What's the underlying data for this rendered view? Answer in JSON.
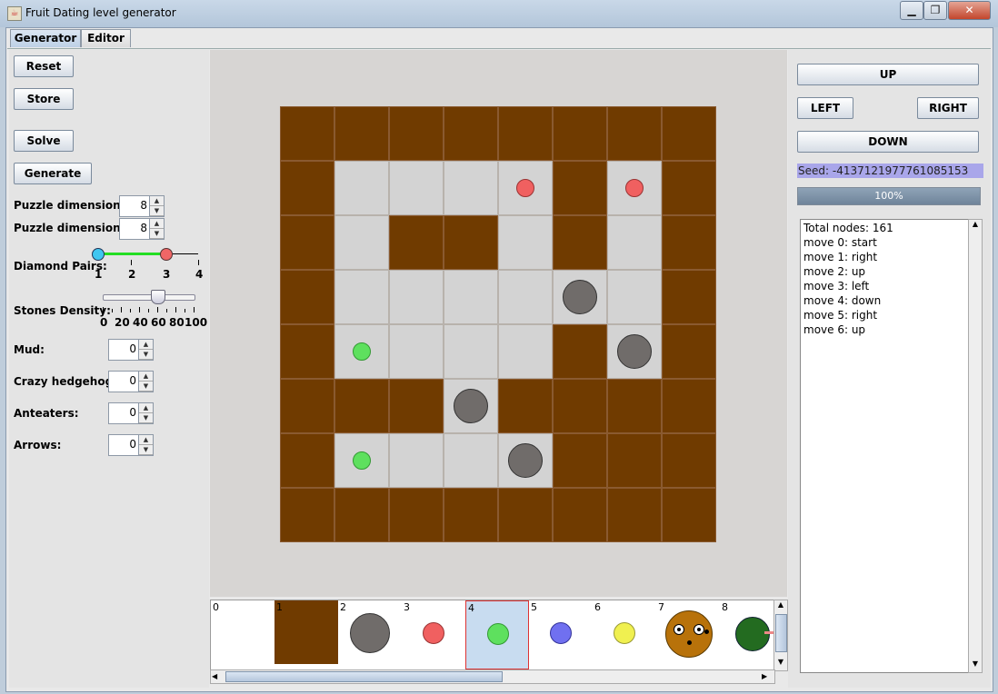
{
  "window": {
    "title": "Fruit Dating level generator",
    "minimize": "▁",
    "maximize": "❐",
    "close": "✕",
    "app_icon": "java-icon"
  },
  "tabs": [
    {
      "label": "Generator",
      "active": true
    },
    {
      "label": "Editor",
      "active": false
    }
  ],
  "left": {
    "reset": "Reset",
    "store": "Store",
    "solve": "Solve",
    "generate": "Generate",
    "dim_x_label": "Puzzle dimension X:",
    "dim_x": "8",
    "dim_y_label": "Puzzle dimension Y:",
    "dim_y": "8",
    "diamond_label": "Diamond Pairs:",
    "diamond_ticks": [
      "1",
      "2",
      "3",
      "4"
    ],
    "stones_label": "Stones Density:",
    "stones_ticks": [
      "0",
      "20",
      "40",
      "60",
      "80",
      "100"
    ],
    "stones_value": 60,
    "mud_label": "Mud:",
    "mud": "0",
    "hedgehogs_label": "Crazy hedgehogs:",
    "hedgehogs": "0",
    "anteaters_label": "Anteaters:",
    "anteaters": "0",
    "arrows_label": "Arrows:",
    "arrows": "0"
  },
  "board": {
    "rows": [
      "MMMMMMMM",
      "MEEEEMEM",
      "MEMMEMEM",
      "MEEEEEEM",
      "MEEEEMEM",
      "MMMEMMMM",
      "MEEEEMMM",
      "MMMMMMMM"
    ],
    "pieces": [
      {
        "row": 1,
        "col": 4,
        "kind": "red"
      },
      {
        "row": 1,
        "col": 6,
        "kind": "red"
      },
      {
        "row": 3,
        "col": 5,
        "kind": "stone"
      },
      {
        "row": 4,
        "col": 1,
        "kind": "green"
      },
      {
        "row": 4,
        "col": 6,
        "kind": "stone"
      },
      {
        "row": 5,
        "col": 3,
        "kind": "stone"
      },
      {
        "row": 6,
        "col": 1,
        "kind": "green"
      },
      {
        "row": 6,
        "col": 4,
        "kind": "stone"
      }
    ]
  },
  "palette": [
    {
      "num": "0",
      "kind": "empty"
    },
    {
      "num": "1",
      "kind": "mud"
    },
    {
      "num": "2",
      "kind": "stone"
    },
    {
      "num": "3",
      "kind": "red"
    },
    {
      "num": "4",
      "kind": "green",
      "selected": true
    },
    {
      "num": "5",
      "kind": "blue"
    },
    {
      "num": "6",
      "kind": "yellow"
    },
    {
      "num": "7",
      "kind": "hedgehog"
    },
    {
      "num": "8",
      "kind": "anteater"
    }
  ],
  "right": {
    "up": "UP",
    "left": "LEFT",
    "right": "RIGHT",
    "down": "DOWN",
    "seed": "Seed: -4137121977761085153",
    "progress": "100%",
    "log": [
      "Total nodes: 161",
      "move 0: start",
      "move 1: right",
      "move 2: up",
      "move 3: left",
      "move 4: down",
      "move 5: right",
      "move 6: up"
    ]
  },
  "colors": {
    "mud": "#703b00",
    "empty": "#d3d3d3",
    "red": "#f06060",
    "green": "#5ee05e",
    "stone": "#706c6a",
    "blue": "#7070f0",
    "yellow": "#f0f050",
    "selection": "#c8dcf0"
  }
}
